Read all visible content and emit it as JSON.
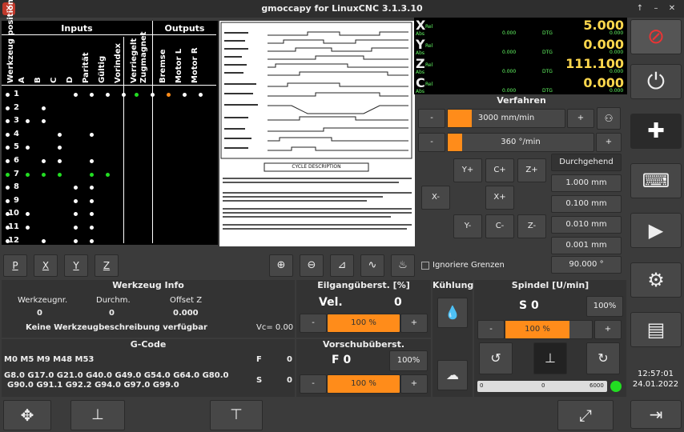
{
  "window": {
    "title": "gmoccapy for LinuxCNC  3.1.3.10"
  },
  "io": {
    "inputs_title": "Inputs",
    "outputs_title": "Outputs",
    "columns": [
      "Werkzeug position",
      "A",
      "B",
      "C",
      "D",
      "Parität",
      "Gültig",
      "Vorindex",
      "Verriegelt",
      "Zugmagnet",
      "Bremse",
      "Motor L",
      "Motor R"
    ],
    "rows": [
      "1",
      "2",
      "3",
      "4",
      "5",
      "6",
      "7",
      "8",
      "9",
      "10",
      "11",
      "12"
    ]
  },
  "doc": {
    "caption": "CYCLE DESCRIPTION"
  },
  "dro": {
    "axes": [
      {
        "name": "X",
        "rel": "Rel",
        "abs": "Abs",
        "dtg": "DTG",
        "value": "5.000",
        "abs_val": "0.000",
        "dtg_val": "0.000"
      },
      {
        "name": "Y",
        "rel": "Rel",
        "abs": "Abs",
        "dtg": "DTG",
        "value": "0.000",
        "abs_val": "0.000",
        "dtg_val": "0.000"
      },
      {
        "name": "Z",
        "rel": "Rel",
        "abs": "Abs",
        "dtg": "DTG",
        "value": "111.100",
        "abs_val": "0.000",
        "dtg_val": "0.000"
      },
      {
        "name": "C",
        "rel": "Rel",
        "abs": "Abs",
        "dtg": "DTG",
        "value": "0.000",
        "abs_val": "0.000",
        "dtg_val": "0.000"
      }
    ]
  },
  "jog": {
    "title": "Verfahren",
    "speed": "3000 mm/min",
    "angular": "360 °/min",
    "minus": "-",
    "plus": "+",
    "ypos": "Y+",
    "cpos": "C+",
    "zpos": "Z+",
    "xneg": "X-",
    "xpos": "X+",
    "yneg": "Y-",
    "cneg": "C-",
    "zneg": "Z-",
    "continuous": "Durchgehend",
    "incr": [
      "1.000 mm",
      "0.100 mm",
      "0.010 mm",
      "0.001 mm"
    ],
    "angle": "90.000 °",
    "ignore_limits": "Ignoriere Grenzen"
  },
  "view": {
    "btns": [
      "P",
      "X",
      "Y",
      "Z"
    ]
  },
  "tool": {
    "title": "Werkzeug Info",
    "no_lbl": "Werkzeugnr.",
    "dia_lbl": "Durchm.",
    "off_lbl": "Offset Z",
    "no": "0",
    "dia": "0",
    "off": "0.000",
    "desc": "Keine Werkzeugbeschreibung verfügbar",
    "vc": "Vc= 0.00"
  },
  "gcode": {
    "title": "G-Code",
    "m": "M0 M5 M9 M48 M53",
    "f_lbl": "F",
    "f": "0",
    "s_lbl": "S",
    "s": "0",
    "g1": "G8.0 G17.0 G21.0 G40.0 G49.0 G54.0 G64.0 G80.0",
    "g2": "G90.0 G91.1 G92.2 G94.0 G97.0 G99.0"
  },
  "rapid": {
    "title": "Eilgangüberst. [%]",
    "vel_lbl": "Vel.",
    "vel": "0",
    "pct": "100 %",
    "minus": "-",
    "plus": "+"
  },
  "feed": {
    "title": "Vorschubüberst.",
    "f": "F  0",
    "btn": "100%",
    "pct": "100 %",
    "minus": "-",
    "plus": "+"
  },
  "cool": {
    "title": "Kühlung"
  },
  "spindle": {
    "title": "Spindel [U/min]",
    "s": "S 0",
    "btn": "100%",
    "pct": "100 %",
    "minus": "-",
    "plus": "+",
    "bar_min": "0",
    "bar_mid": "0",
    "bar_max": "6000"
  },
  "clock": {
    "time": "12:57:01",
    "date": "24.01.2022"
  }
}
